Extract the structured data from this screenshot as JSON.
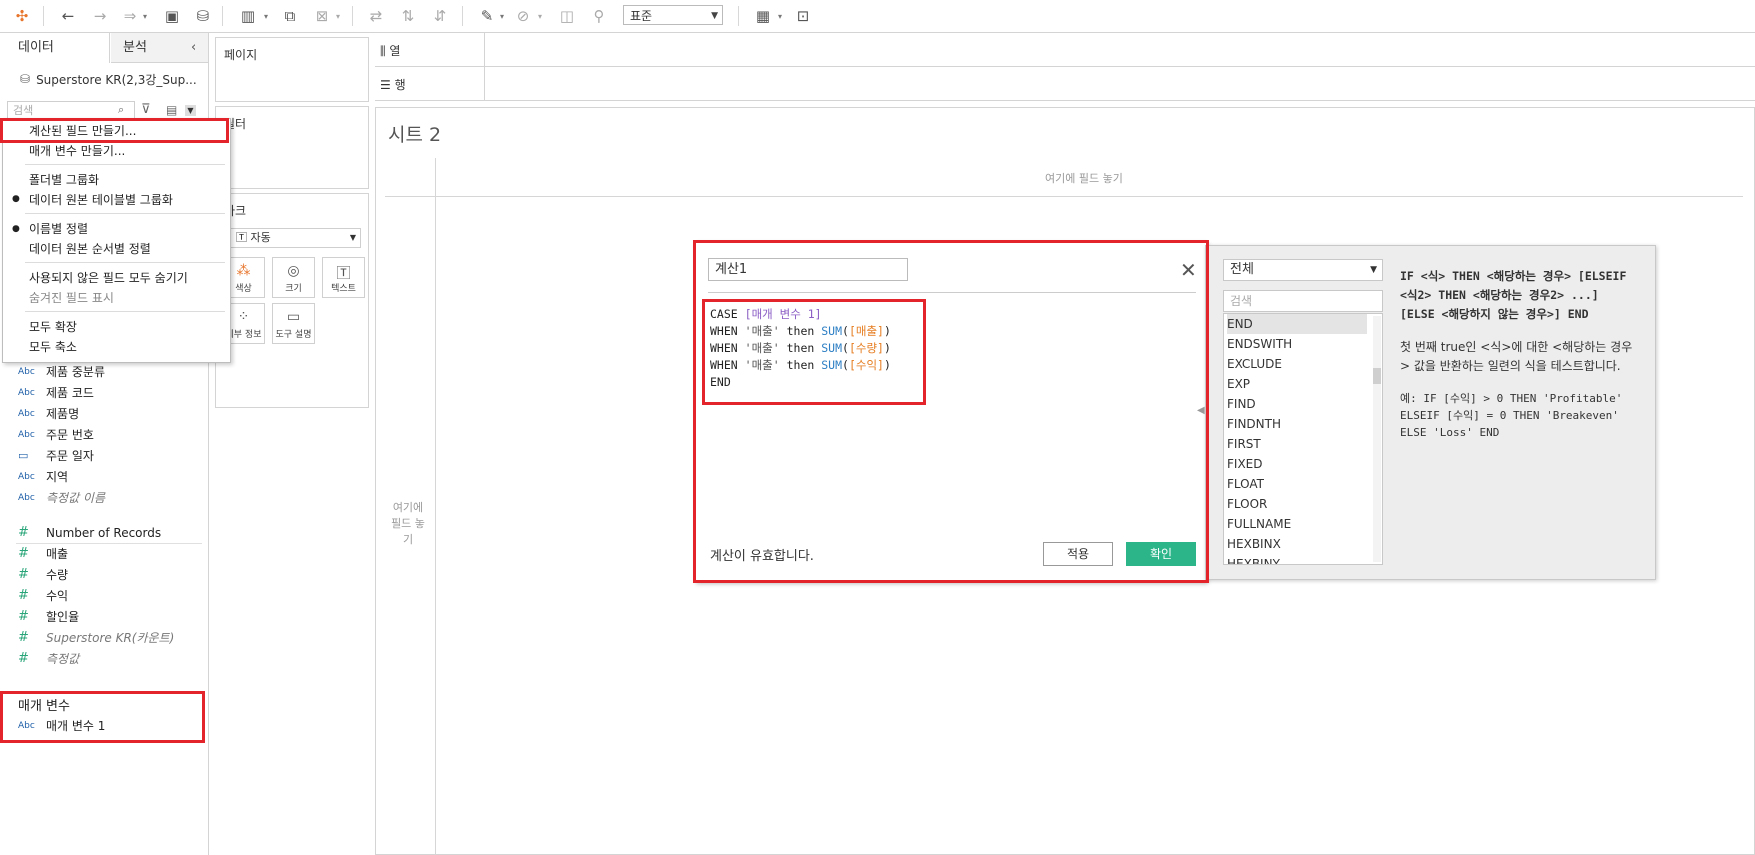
{
  "toolbar": {
    "icons": [
      "tableau-logo-icon",
      "undo-icon",
      "redo-icon",
      "forward-icon",
      "save-icon",
      "new-datasource-icon",
      "new-sheet-icon",
      "duplicate-icon",
      "clear-icon",
      "swap-icon",
      "sort-asc-icon",
      "sort-desc-icon",
      "highlight-icon",
      "group-icon",
      "label-icon",
      "pin-icon",
      "show-me-icon",
      "presentation-icon"
    ],
    "fit_value": "표준"
  },
  "left_pane": {
    "tab_data": "데이터",
    "tab_analysis": "분석",
    "collapse_icon": "‹",
    "datasource_name": "Superstore KR(2,3강_Sup...",
    "search_placeholder": "검색",
    "fields": [
      {
        "type": "Abc",
        "name": "제품 중분류",
        "italic": false
      },
      {
        "type": "Abc",
        "name": "제품 코드",
        "italic": false
      },
      {
        "type": "Abc",
        "name": "제품명",
        "italic": false
      },
      {
        "type": "Abc",
        "name": "주문 번호",
        "italic": false
      },
      {
        "type": "date",
        "name": "주문 일자",
        "italic": false
      },
      {
        "type": "Abc",
        "name": "지역",
        "italic": false
      },
      {
        "type": "Abc",
        "name": "측정값 이름",
        "italic": true
      }
    ],
    "measures": [
      {
        "type": "#",
        "name": "Number of Records",
        "italic": false
      },
      {
        "type": "#",
        "name": "매출",
        "italic": false
      },
      {
        "type": "#",
        "name": "수량",
        "italic": false
      },
      {
        "type": "#",
        "name": "수익",
        "italic": false
      },
      {
        "type": "#",
        "name": "할인율",
        "italic": false
      },
      {
        "type": "#",
        "name": "Superstore KR(카운트)",
        "italic": true
      },
      {
        "type": "#",
        "name": "측정값",
        "italic": true
      }
    ],
    "param_section_title": "매개 변수",
    "param_type": "Abc",
    "param_name": "매개 변수 1"
  },
  "context_menu": {
    "create_calc": "계산된 필드 만들기...",
    "create_param": "매개 변수 만들기...",
    "group_folder": "폴더별 그룹화",
    "group_table": "데이터 원본 테이블별 그룹화",
    "sort_name": "이름별 정렬",
    "sort_source": "데이터 원본 순서별 정렬",
    "hide_unused": "사용되지 않은 필드 모두 숨기기",
    "show_hidden": "숨겨진 필드 표시",
    "expand_all": "모두 확장",
    "collapse_all": "모두 축소"
  },
  "shelves": {
    "pages": "페이지",
    "filters": "필터",
    "marks": "마크",
    "marks_type": "자동",
    "mark_buttons": [
      "색상",
      "크기",
      "텍스트",
      "세부 정보",
      "도구 설명"
    ],
    "columns": "열",
    "rows": "행"
  },
  "canvas": {
    "sheet_title": "시트 2",
    "col_drop": "여기에 필드 놓기",
    "row_drop": "여기에 필드 놓기"
  },
  "calc_dialog": {
    "name": "계산1",
    "status": "계산이 유효합니다.",
    "apply": "적용",
    "ok": "확인",
    "code": {
      "l1_kw": "CASE",
      "l1_param": "[매개 변수 1]",
      "when": "WHEN",
      "then": "then",
      "sum": "SUM",
      "str_sales": "'매출'",
      "f_sales": "[매출]",
      "f_qty": "[수량]",
      "f_profit": "[수익]",
      "end": "END"
    }
  },
  "func_panel": {
    "category": "전체",
    "search_placeholder": "검색",
    "functions": [
      "END",
      "ENDSWITH",
      "EXCLUDE",
      "EXP",
      "FIND",
      "FINDNTH",
      "FIRST",
      "FIXED",
      "FLOAT",
      "FLOOR",
      "FULLNAME",
      "HEXBINX",
      "HEXBINY"
    ],
    "selected": "END",
    "syntax": "IF <식> THEN <해당하는 경우> [ELSEIF <식2> THEN <해당하는 경우2> ...] [ELSE <해당하지 않는 경우>] END",
    "description": "첫 번째 true인 <식>에 대한 <해당하는 경우> 값을 반환하는 일련의 식을 테스트합니다.",
    "example": "예: IF [수익] > 0 THEN 'Profitable' ELSEIF [수익] = 0 THEN 'Breakeven' ELSE 'Loss' END"
  },
  "highlight_color": "#e3242b",
  "accent_green": "#2db58a"
}
